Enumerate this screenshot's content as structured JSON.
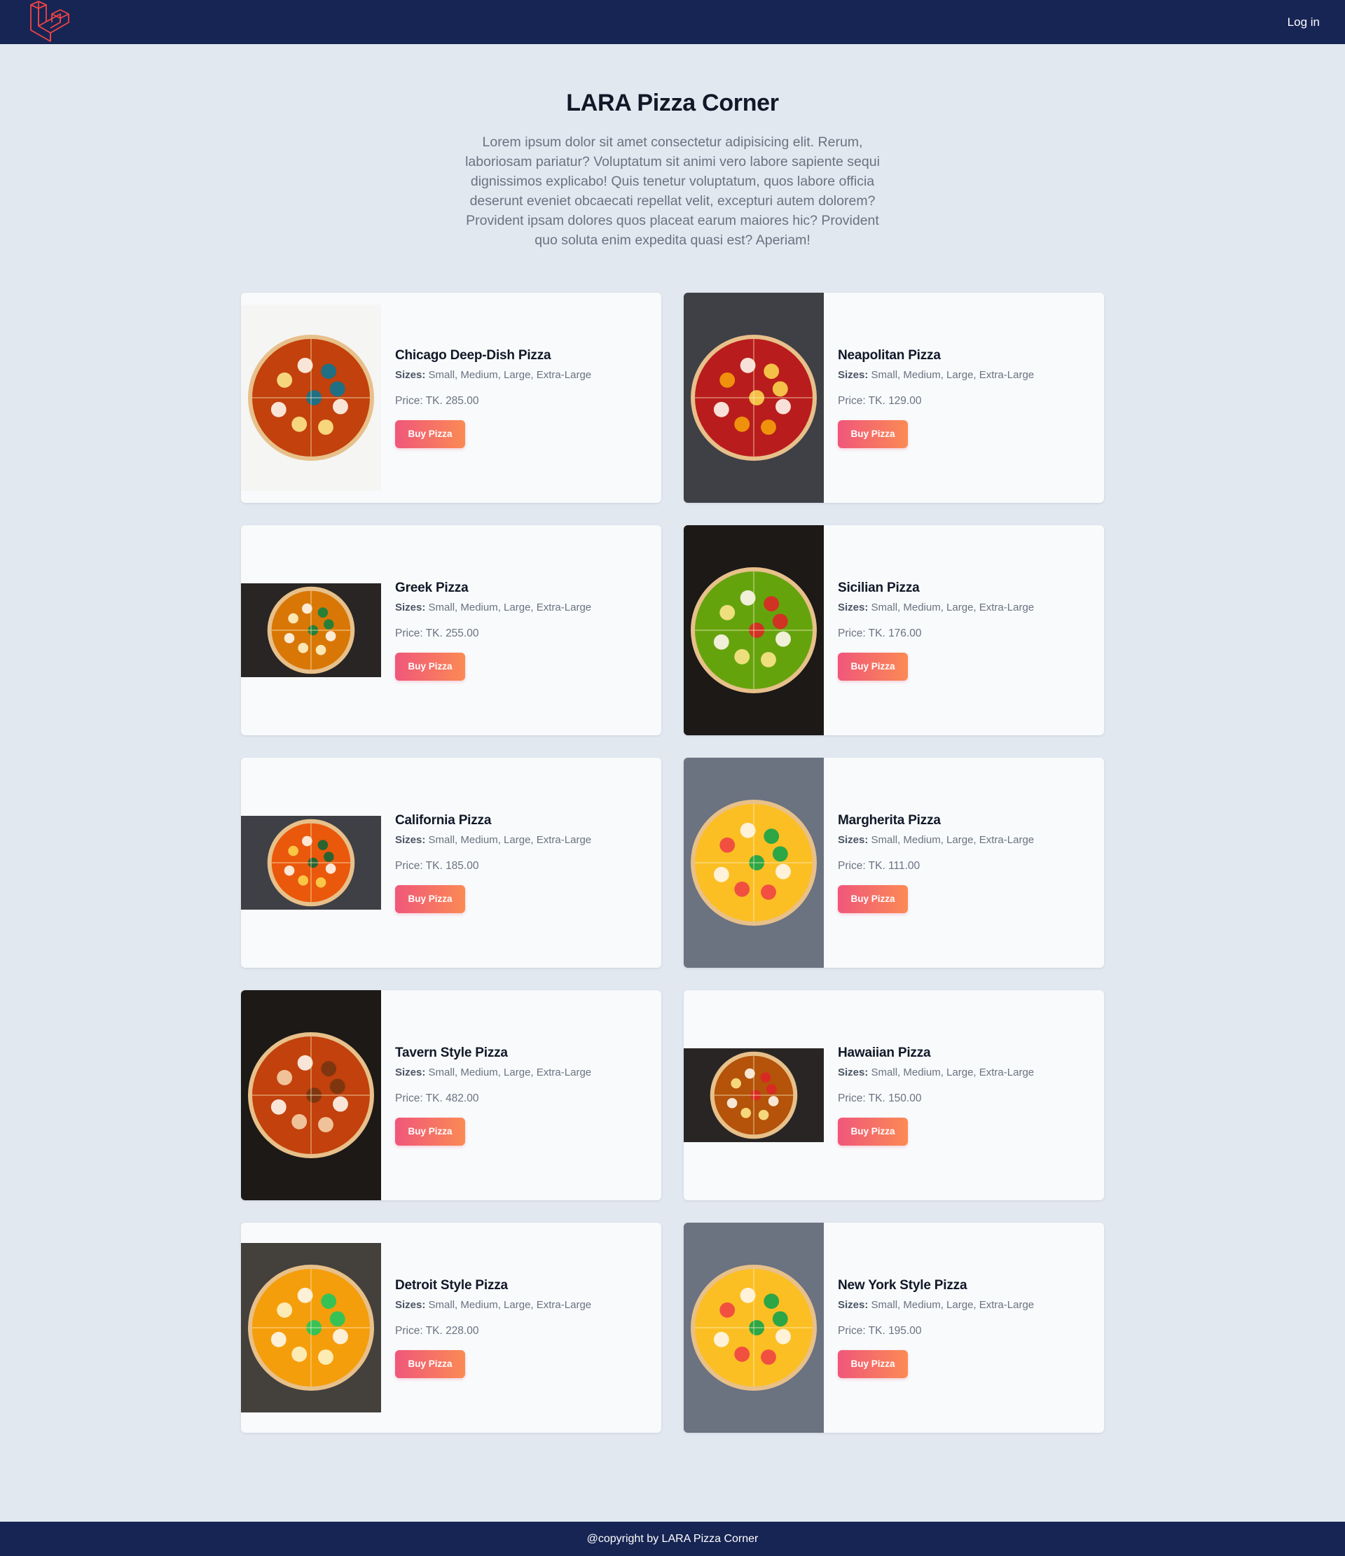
{
  "header": {
    "login_label": "Log in",
    "logo_icon": "laravel-logo-icon",
    "accent": "#ef4444"
  },
  "hero": {
    "title": "LARA Pizza Corner",
    "description": "Lorem ipsum dolor sit amet consectetur adipisicing elit. Rerum, laboriosam pariatur? Voluptatum sit animi vero labore sapiente sequi dignissimos explicabo! Quis tenetur voluptatum, quos labore officia deserunt eveniet obcaecati repellat velit, excepturi autem dolorem? Provident ipsam dolores quos placeat earum maiores hic? Provident quo soluta enim expedita quasi est? Aperiam!"
  },
  "pizzas": [
    {
      "name": "Chicago Deep-Dish Pizza",
      "sizes_label": "Sizes:",
      "sizes": "Small, Medium, Large, Extra-Large",
      "price": "Price: TK. 285.00",
      "button": "Buy Pizza",
      "photo": "tall"
    },
    {
      "name": "Neapolitan Pizza",
      "sizes_label": "Sizes:",
      "sizes": "Small, Medium, Large, Extra-Large",
      "price": "Price: TK. 129.00",
      "button": "Buy Pizza",
      "photo": "full"
    },
    {
      "name": "Greek Pizza",
      "sizes_label": "Sizes:",
      "sizes": "Small, Medium, Large, Extra-Large",
      "price": "Price: TK. 255.00",
      "button": "Buy Pizza",
      "photo": "wide"
    },
    {
      "name": "Sicilian Pizza",
      "sizes_label": "Sizes:",
      "sizes": "Small, Medium, Large, Extra-Large",
      "price": "Price: TK. 176.00",
      "button": "Buy Pizza",
      "photo": "full"
    },
    {
      "name": "California Pizza",
      "sizes_label": "Sizes:",
      "sizes": "Small, Medium, Large, Extra-Large",
      "price": "Price: TK. 185.00",
      "button": "Buy Pizza",
      "photo": "wide"
    },
    {
      "name": "Margherita Pizza",
      "sizes_label": "Sizes:",
      "sizes": "Small, Medium, Large, Extra-Large",
      "price": "Price: TK. 111.00",
      "button": "Buy Pizza",
      "photo": "full"
    },
    {
      "name": "Tavern Style Pizza",
      "sizes_label": "Sizes:",
      "sizes": "Small, Medium, Large, Extra-Large",
      "price": "Price: TK. 482.00",
      "button": "Buy Pizza",
      "photo": "full"
    },
    {
      "name": "Hawaiian Pizza",
      "sizes_label": "Sizes:",
      "sizes": "Small, Medium, Large, Extra-Large",
      "price": "Price: TK. 150.00",
      "button": "Buy Pizza",
      "photo": "wide"
    },
    {
      "name": "Detroit Style Pizza",
      "sizes_label": "Sizes:",
      "sizes": "Small, Medium, Large, Extra-Large",
      "price": "Price: TK. 228.00",
      "button": "Buy Pizza",
      "photo": "square"
    },
    {
      "name": "New York Style Pizza",
      "sizes_label": "Sizes:",
      "sizes": "Small, Medium, Large, Extra-Large",
      "price": "Price: TK. 195.00",
      "button": "Buy Pizza",
      "photo": "full"
    }
  ],
  "footer": {
    "text": "@copyright by LARA Pizza Corner"
  }
}
